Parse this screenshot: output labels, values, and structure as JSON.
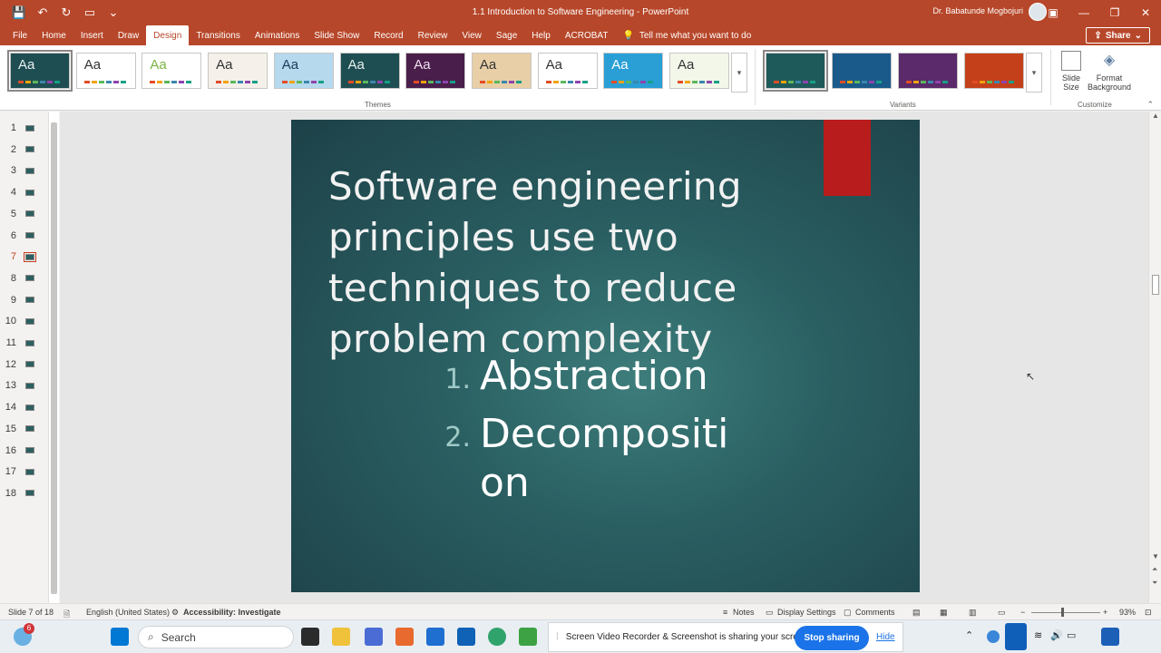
{
  "app": {
    "doc_title": "1.1 Introduction to Software Engineering  -  PowerPoint",
    "user_name": "Dr. Babatunde Mogbojuri",
    "share_label": "Share"
  },
  "tabs": [
    "File",
    "Home",
    "Insert",
    "Draw",
    "Design",
    "Transitions",
    "Animations",
    "Slide Show",
    "Record",
    "Review",
    "View",
    "Sage",
    "Help",
    "ACROBAT"
  ],
  "active_tab": "Design",
  "tell_me": "Tell me what you want to do",
  "ribbon": {
    "themes_label": "Themes",
    "variants_label": "Variants",
    "customize_label": "Customize",
    "slide_size_label": "Slide Size",
    "format_background_label": "Format Background",
    "theme_aa": "Aa"
  },
  "thumbnails": [
    "1",
    "2",
    "3",
    "4",
    "5",
    "6",
    "7",
    "8",
    "9",
    "10",
    "11",
    "12",
    "13",
    "14",
    "15",
    "16",
    "17",
    "18"
  ],
  "active_slide": 7,
  "slide": {
    "title": "Software engineering principles use two techniques to reduce problem complexity",
    "items": [
      {
        "num": "1.",
        "text": "Abstraction"
      },
      {
        "num": "2.",
        "text": "Decompositi on"
      }
    ]
  },
  "status": {
    "slide_of": "Slide 7 of 18",
    "language": "English (United States)",
    "accessibility": "Accessibility: Investigate",
    "notes": "Notes",
    "display_settings": "Display Settings",
    "comments": "Comments",
    "zoom": "93%"
  },
  "taskbar": {
    "search": "Search",
    "notification_count": "6",
    "share_message": "Screen Video Recorder & Screenshot is sharing your screen.",
    "stop_sharing": "Stop sharing",
    "hide": "Hide"
  },
  "colors": {
    "brand": "#b7472a",
    "slide_bg": "#2a5f62",
    "accent_red": "#b81c1c"
  }
}
